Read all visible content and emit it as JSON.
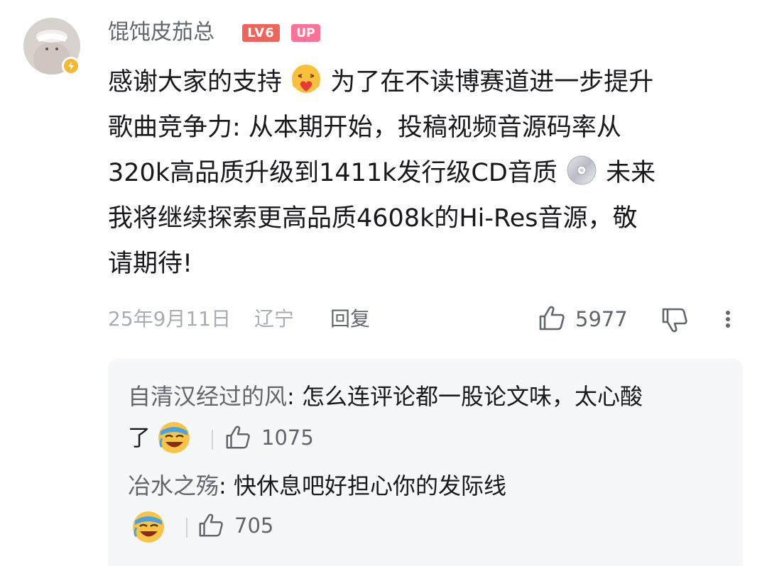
{
  "user": {
    "name": "馄饨皮茄总",
    "level": "LV6",
    "up_badge": "UP"
  },
  "comment": {
    "lines": [
      "感谢大家的支持",
      "为了在不读博赛道进一步提升",
      "歌曲竞争力: 从本期开始，投稿视频音源码率从",
      "320k高品质升级到1411k发行级CD音质",
      "未来",
      "我将继续探索更高品质4608k的Hi-Res音源，敬",
      "请期待!"
    ],
    "date": "25年9月11日",
    "location": "辽宁",
    "reply_label": "回复",
    "likes": "5977"
  },
  "replies": [
    {
      "author": "自清汉经过的风",
      "text_line1": ": 怎么连评论都一股论文味，太心酸",
      "text_line2": "了",
      "likes": "1075"
    },
    {
      "author": "冶水之殇",
      "text_line1": ": 快休息吧好担心你的发际线",
      "likes": "705"
    }
  ],
  "icons": {
    "hug_emoji": "hugging-heart-emoji",
    "cd_emoji": "cd-disc-emoji",
    "crying_laugh_emoji": "crying-laugh-emoji",
    "like": "thumbs-up-icon",
    "dislike": "thumbs-down-icon",
    "more": "more-vertical-icon"
  },
  "colors": {
    "level_badge": "#f0655b",
    "up_badge": "#fb7299",
    "reply_bg": "#f6f7f8",
    "muted_text": "#a8adb4"
  }
}
